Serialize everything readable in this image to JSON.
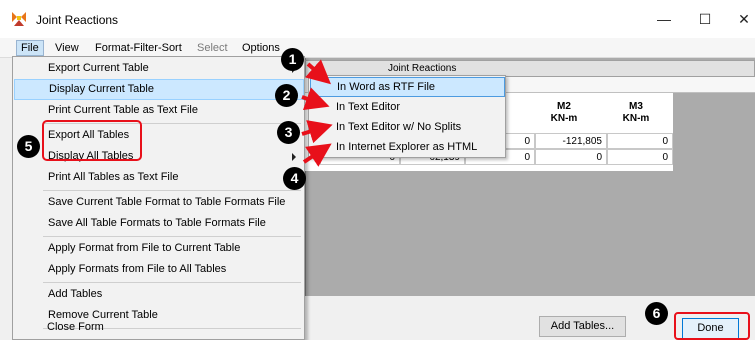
{
  "window": {
    "title": "Joint Reactions",
    "controls": {
      "minimize": "—",
      "maximize": "☐",
      "close": "✕"
    }
  },
  "menubar": {
    "items": [
      {
        "label": "File",
        "state": "active"
      },
      {
        "label": "View",
        "state": "normal"
      },
      {
        "label": "Format-Filter-Sort",
        "state": "normal"
      },
      {
        "label": "Select",
        "state": "disabled"
      },
      {
        "label": "Options",
        "state": "normal"
      }
    ]
  },
  "file_menu": {
    "items": [
      {
        "label": "Export Current Table",
        "has_submenu": true
      },
      {
        "label": "Display Current Table",
        "has_submenu": true,
        "highlighted": true
      },
      {
        "label": "Print Current Table as Text File"
      },
      {
        "label": "Export All Tables",
        "has_submenu": true
      },
      {
        "label": "Display All Tables",
        "has_submenu": true
      },
      {
        "label": "Print All Tables as Text File"
      },
      {
        "label": "Save Current Table Format to Table Formats File"
      },
      {
        "label": "Save All Table Formats to Table Formats File"
      },
      {
        "label": "Apply Format from File to Current Table"
      },
      {
        "label": "Apply Formats from File to All Tables"
      },
      {
        "label": "Add Tables"
      },
      {
        "label": "Remove Current Table"
      },
      {
        "label": "Close Form"
      }
    ]
  },
  "submenu": {
    "items": [
      {
        "label": "In Word as RTF File",
        "highlighted": true
      },
      {
        "label": "In Text Editor"
      },
      {
        "label": "In Text Editor w/ No Splits"
      },
      {
        "label": "In Internet Explorer as HTML"
      }
    ]
  },
  "table": {
    "caption": "Joint Reactions",
    "columns": [
      {
        "name": "M2",
        "unit": "KN-m"
      },
      {
        "name": "M3",
        "unit": "KN-m"
      }
    ],
    "partial_header": "n",
    "rows": [
      {
        "left": "0",
        "m2": "-121,805",
        "m3": "0"
      },
      {
        "left": "0",
        "m2": "0",
        "m3": "0",
        "extra": "0",
        "extra_value": "62,139"
      }
    ]
  },
  "buttons": {
    "add_tables": "Add Tables...",
    "done": "Done"
  },
  "annotations": {
    "badges": [
      "1",
      "2",
      "3",
      "4",
      "5",
      "6"
    ]
  }
}
